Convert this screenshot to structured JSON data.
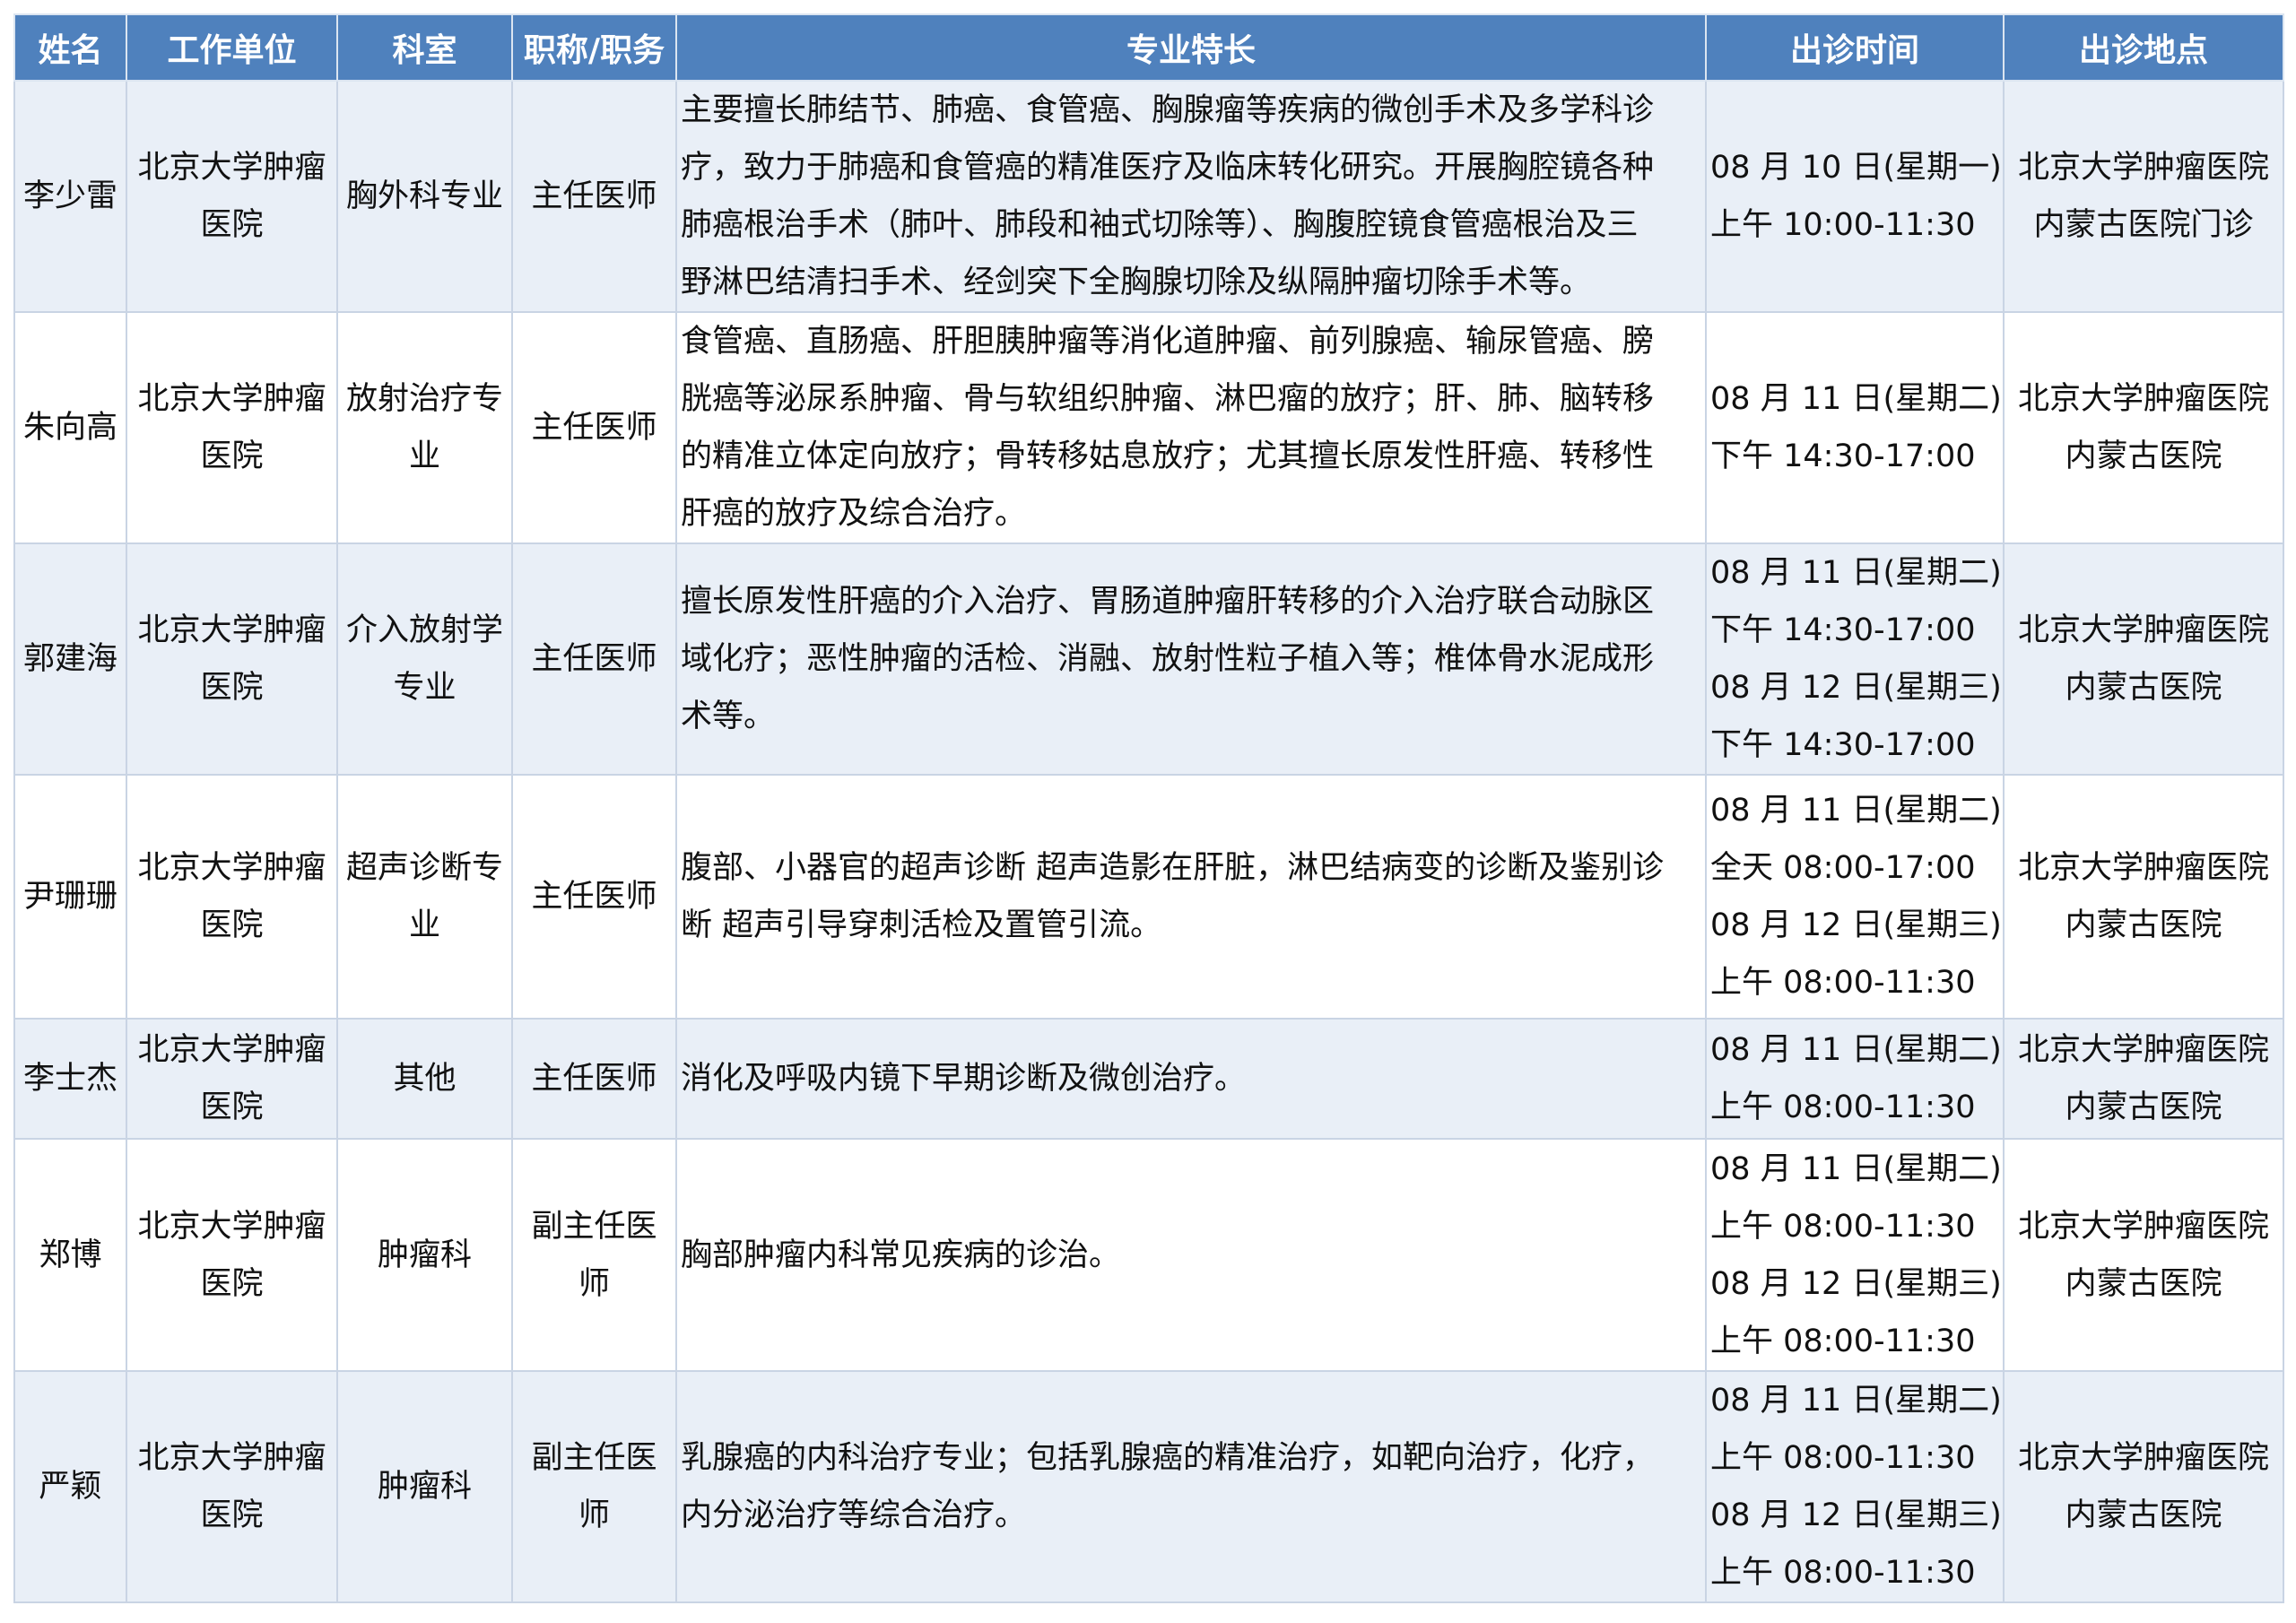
{
  "headers": {
    "name": "姓名",
    "unit": "工作单位",
    "dept": "科室",
    "title": "职称/职务",
    "spec": "专业特长",
    "time": "出诊时间",
    "place": "出诊地点"
  },
  "rows": [
    {
      "name": "李少雷",
      "unit": [
        "北京大学肿瘤",
        "医院"
      ],
      "dept": [
        "胸外科专业"
      ],
      "title": [
        "主任医师"
      ],
      "spec": [
        "主要擅长肺结节、肺癌、食管癌、胸腺瘤等疾病的微创手术及多学科诊",
        "疗，致力于肺癌和食管癌的精准医疗及临床转化研究。开展胸腔镜各种",
        "肺癌根治手术（肺叶、肺段和袖式切除等）、胸腹腔镜食管癌根治及三",
        "野淋巴结清扫手术、经剑突下全胸腺切除及纵隔肿瘤切除手术等。"
      ],
      "time": [
        "08 月 10 日(星期一)",
        "上午 10:00-11:30"
      ],
      "place": [
        "北京大学肿瘤医院",
        "内蒙古医院门诊"
      ]
    },
    {
      "name": "朱向高",
      "unit": [
        "北京大学肿瘤",
        "医院"
      ],
      "dept": [
        "放射治疗专",
        "业"
      ],
      "title": [
        "主任医师"
      ],
      "spec": [
        "食管癌、直肠癌、肝胆胰肿瘤等消化道肿瘤、前列腺癌、输尿管癌、膀",
        "胱癌等泌尿系肿瘤、骨与软组织肿瘤、淋巴瘤的放疗；肝、肺、脑转移",
        "的精准立体定向放疗；骨转移姑息放疗；尤其擅长原发性肝癌、转移性",
        "肝癌的放疗及综合治疗。"
      ],
      "time": [
        "08 月 11 日(星期二)",
        "下午 14:30-17:00"
      ],
      "place": [
        "北京大学肿瘤医院",
        "内蒙古医院"
      ]
    },
    {
      "name": "郭建海",
      "unit": [
        "北京大学肿瘤",
        "医院"
      ],
      "dept": [
        "介入放射学",
        "专业"
      ],
      "title": [
        "主任医师"
      ],
      "spec": [
        "擅长原发性肝癌的介入治疗、胃肠道肿瘤肝转移的介入治疗联合动脉区",
        "域化疗；恶性肿瘤的活检、消融、放射性粒子植入等；椎体骨水泥成形",
        "术等。"
      ],
      "time": [
        "08 月 11 日(星期二)",
        "下午 14:30-17:00",
        "08 月 12 日(星期三)",
        "下午 14:30-17:00"
      ],
      "place": [
        "北京大学肿瘤医院",
        "内蒙古医院"
      ]
    },
    {
      "name": "尹珊珊",
      "unit": [
        "北京大学肿瘤",
        "医院"
      ],
      "dept": [
        "超声诊断专",
        "业"
      ],
      "title": [
        "主任医师"
      ],
      "spec": [
        "腹部、小器官的超声诊断 超声造影在肝脏，淋巴结病变的诊断及鉴别诊",
        "断 超声引导穿刺活检及置管引流。"
      ],
      "time": [
        "08 月 11 日(星期二)",
        "全天 08:00-17:00",
        "08 月 12 日(星期三)",
        "上午 08:00-11:30"
      ],
      "place": [
        "北京大学肿瘤医院",
        "内蒙古医院"
      ]
    },
    {
      "name": "李士杰",
      "unit": [
        "北京大学肿瘤",
        "医院"
      ],
      "dept": [
        "其他"
      ],
      "title": [
        "主任医师"
      ],
      "spec": [
        "消化及呼吸内镜下早期诊断及微创治疗。"
      ],
      "time": [
        "08 月 11 日(星期二)",
        "上午 08:00-11:30"
      ],
      "place": [
        "北京大学肿瘤医院",
        "内蒙古医院"
      ]
    },
    {
      "name": "郑博",
      "unit": [
        "北京大学肿瘤",
        "医院"
      ],
      "dept": [
        "肿瘤科"
      ],
      "title": [
        "副主任医",
        "师"
      ],
      "spec": [
        "胸部肿瘤内科常见疾病的诊治。"
      ],
      "time": [
        "08 月 11 日(星期二)",
        "上午 08:00-11:30",
        "08 月 12 日(星期三)",
        "上午 08:00-11:30"
      ],
      "place": [
        "北京大学肿瘤医院",
        "内蒙古医院"
      ]
    },
    {
      "name": "严颖",
      "unit": [
        "北京大学肿瘤",
        "医院"
      ],
      "dept": [
        "肿瘤科"
      ],
      "title": [
        "副主任医",
        "师"
      ],
      "spec": [
        "乳腺癌的内科治疗专业；包括乳腺癌的精准治疗，如靶向治疗，化疗，",
        "内分泌治疗等综合治疗。"
      ],
      "time": [
        "08 月 11 日(星期二)",
        "上午 08:00-11:30",
        "08 月 12 日(星期三)",
        "上午 08:00-11:30"
      ],
      "place": [
        "北京大学肿瘤医院",
        "内蒙古医院"
      ]
    }
  ]
}
